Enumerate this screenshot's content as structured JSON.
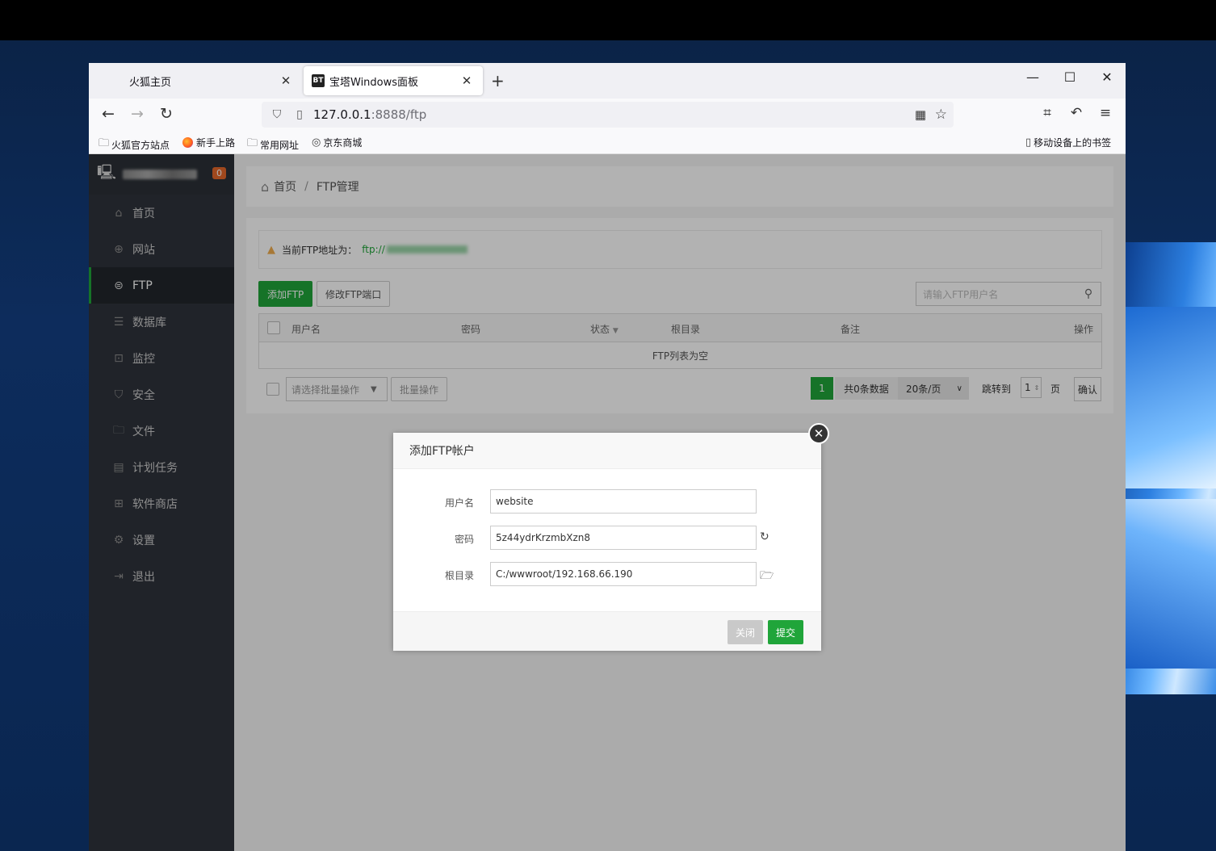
{
  "browser": {
    "tabs": [
      {
        "title": "火狐主页"
      },
      {
        "title": "宝塔Windows面板",
        "favicon": "BT"
      }
    ],
    "url_host": "127.0.0.1",
    "url_path": ":8888/ftp",
    "bookmarks": [
      "火狐官方站点",
      "新手上路",
      "常用网址",
      "京东商城"
    ],
    "mobile_bookmarks": "移动设备上的书签"
  },
  "sidebar": {
    "badge": "0",
    "items": [
      {
        "label": "首页",
        "icon": "home-icon"
      },
      {
        "label": "网站",
        "icon": "globe-icon"
      },
      {
        "label": "FTP",
        "icon": "ftp-icon"
      },
      {
        "label": "数据库",
        "icon": "database-icon"
      },
      {
        "label": "监控",
        "icon": "monitor-icon"
      },
      {
        "label": "安全",
        "icon": "shield-icon"
      },
      {
        "label": "文件",
        "icon": "folder-icon"
      },
      {
        "label": "计划任务",
        "icon": "calendar-icon"
      },
      {
        "label": "软件商店",
        "icon": "apps-icon"
      },
      {
        "label": "设置",
        "icon": "gear-icon"
      },
      {
        "label": "退出",
        "icon": "logout-icon"
      }
    ],
    "active": "FTP"
  },
  "breadcrumb": {
    "home": "首页",
    "current": "FTP管理"
  },
  "notice": {
    "label": "当前FTP地址为：",
    "addr_prefix": "ftp://"
  },
  "toolbar": {
    "add": "添加FTP",
    "change_port": "修改FTP端口",
    "search_placeholder": "请输入FTP用户名"
  },
  "table": {
    "headers": [
      "用户名",
      "密码",
      "状态",
      "根目录",
      "备注",
      "操作"
    ],
    "empty": "FTP列表为空"
  },
  "batch": {
    "select_placeholder": "请选择批量操作",
    "button": "批量操作"
  },
  "pager": {
    "current": "1",
    "total": "共0条数据",
    "size": "20条/页",
    "jump_label": "跳转到",
    "jump_value": "1",
    "page_label": "页",
    "confirm": "确认"
  },
  "dialog": {
    "title": "添加FTP帐户",
    "fields": [
      {
        "label": "用户名",
        "value": "website"
      },
      {
        "label": "密码",
        "value": "5z44ydrKrzmbXzn8"
      },
      {
        "label": "根目录",
        "value": "C:/wwwroot/192.168.66.190"
      }
    ],
    "close": "关闭",
    "submit": "提交"
  },
  "colors": {
    "accent": "#20a53a",
    "sidebar": "#2f333b",
    "badge": "#e6672a"
  }
}
